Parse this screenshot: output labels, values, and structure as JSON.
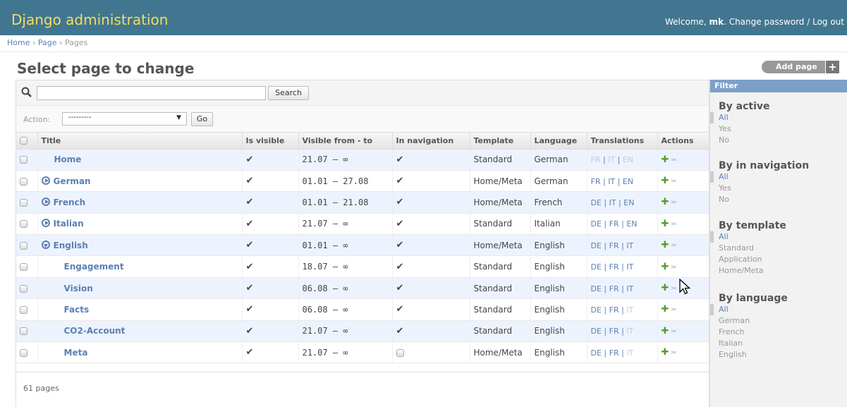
{
  "header": {
    "brand": "Django administration",
    "welcome": "Welcome,",
    "user": "mk",
    "dot": ".",
    "change_password": "Change password",
    "sep": " / ",
    "logout": "Log out"
  },
  "breadcrumbs": {
    "home": "Home",
    "sep": "›",
    "app": "Page",
    "current": "Pages"
  },
  "page_title": "Select page to change",
  "add_button": "Add page",
  "search": {
    "value": "",
    "button": "Search"
  },
  "actions": {
    "label": "Action:",
    "selected": "---------",
    "go": "Go"
  },
  "table": {
    "headers": [
      "Title",
      "Is visible",
      "Visible from - to",
      "In navigation",
      "Template",
      "Language",
      "Translations",
      "Actions"
    ],
    "rows": [
      {
        "title": "Home",
        "level": 0,
        "toggle": "none",
        "visible": "✔",
        "range": "21.07 – ∞",
        "nav": "✔",
        "template": "Standard",
        "language": "German",
        "t1": "FR",
        "t2": "IT",
        "t3": "EN",
        "t1off": true,
        "t2off": true,
        "t3off": true
      },
      {
        "title": "German",
        "level": 0,
        "toggle": "closed",
        "visible": "✔",
        "range": "01.01 – 27.08",
        "nav": "✔",
        "template": "Home/Meta",
        "language": "German",
        "t1": "FR",
        "t2": "IT",
        "t3": "EN",
        "t1off": false,
        "t2off": false,
        "t3off": false
      },
      {
        "title": "French",
        "level": 0,
        "toggle": "closed",
        "visible": "✔",
        "range": "01.01 – 21.08",
        "nav": "✔",
        "template": "Home/Meta",
        "language": "French",
        "t1": "DE",
        "t2": "IT",
        "t3": "EN",
        "t1off": false,
        "t2off": false,
        "t3off": false
      },
      {
        "title": "Italian",
        "level": 0,
        "toggle": "closed",
        "visible": "✔",
        "range": "21.07 – ∞",
        "nav": "✔",
        "template": "Standard",
        "language": "Italian",
        "t1": "DE",
        "t2": "FR",
        "t3": "EN",
        "t1off": false,
        "t2off": false,
        "t3off": false
      },
      {
        "title": "English",
        "level": 0,
        "toggle": "open",
        "visible": "✔",
        "range": "01.01 – ∞",
        "nav": "✔",
        "template": "Home/Meta",
        "language": "English",
        "t1": "DE",
        "t2": "FR",
        "t3": "IT",
        "t1off": false,
        "t2off": false,
        "t3off": false
      },
      {
        "title": "Engagement",
        "level": 1,
        "toggle": "none",
        "visible": "✔",
        "range": "18.07 – ∞",
        "nav": "✔",
        "template": "Standard",
        "language": "English",
        "t1": "DE",
        "t2": "FR",
        "t3": "IT",
        "t1off": false,
        "t2off": false,
        "t3off": false
      },
      {
        "title": "Vision",
        "level": 1,
        "toggle": "none",
        "visible": "✔",
        "range": "06.08 – ∞",
        "nav": "✔",
        "template": "Standard",
        "language": "English",
        "t1": "DE",
        "t2": "FR",
        "t3": "IT",
        "t1off": false,
        "t2off": false,
        "t3off": false
      },
      {
        "title": "Facts",
        "level": 1,
        "toggle": "none",
        "visible": "✔",
        "range": "06.08 – ∞",
        "nav": "✔",
        "template": "Standard",
        "language": "English",
        "t1": "DE",
        "t2": "FR",
        "t3": "IT",
        "t1off": false,
        "t2off": false,
        "t3off": true
      },
      {
        "title": "CO2-Account",
        "level": 1,
        "toggle": "none",
        "visible": "✔",
        "range": "21.07 – ∞",
        "nav": "✔",
        "template": "Standard",
        "language": "English",
        "t1": "DE",
        "t2": "FR",
        "t3": "IT",
        "t1off": false,
        "t2off": false,
        "t3off": true
      },
      {
        "title": "Meta",
        "level": 1,
        "toggle": "none",
        "visible": "✔",
        "range": "21.07 – ∞",
        "nav": "",
        "template": "Home/Meta",
        "language": "English",
        "t1": "DE",
        "t2": "FR",
        "t3": "IT",
        "t1off": false,
        "t2off": false,
        "t3off": true
      }
    ]
  },
  "pagination": "61 pages",
  "filter": {
    "title": "Filter",
    "groups": [
      {
        "heading": "By active",
        "items": [
          "All",
          "Yes",
          "No"
        ]
      },
      {
        "heading": "By in navigation",
        "items": [
          "All",
          "Yes",
          "No"
        ]
      },
      {
        "heading": "By template",
        "items": [
          "All",
          "Standard",
          "Application",
          "Home/Meta"
        ]
      },
      {
        "heading": "By language",
        "items": [
          "All",
          "German",
          "French",
          "Italian",
          "English"
        ]
      }
    ]
  },
  "colors": {
    "header_bg": "#417690",
    "brand": "#f5dd5d",
    "link": "#5b80b2",
    "filter_head": "#7ca0c7",
    "row_alt": "#edf3fe"
  }
}
